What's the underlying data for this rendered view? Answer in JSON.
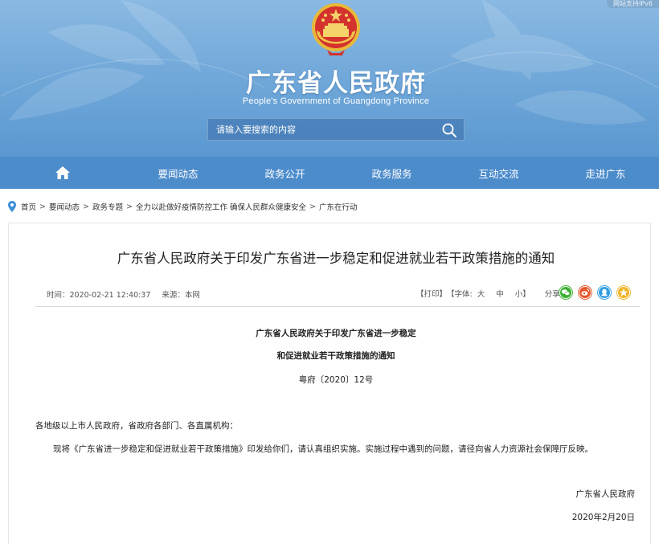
{
  "header": {
    "ipv6_badge": "网站支持IPv6",
    "title": "广东省人民政府",
    "subtitle": "People's Government of Guangdong Province",
    "search": {
      "placeholder": "请输入要搜索的内容"
    }
  },
  "nav": {
    "items": [
      {
        "label": "要闻动态"
      },
      {
        "label": "政务公开"
      },
      {
        "label": "政务服务"
      },
      {
        "label": "互动交流"
      },
      {
        "label": "走进广东"
      }
    ]
  },
  "breadcrumb": {
    "items": [
      "首页",
      "要闻动态",
      "政务专题",
      "全力以赴做好疫情防控工作 确保人民群众健康安全"
    ],
    "current": "广东在行动",
    "separator": ">"
  },
  "article": {
    "title": "广东省人民政府关于印发广东省进一步稳定和促进就业若干政策措施的通知",
    "meta": {
      "time": "时间：2020-02-21 12:40:37",
      "source": "来源：本网"
    },
    "tools": {
      "print": "【打印】",
      "font_label": "【字体:",
      "font_large": "大",
      "font_medium": "中",
      "font_small": "小",
      "font_close": "】",
      "share_label": "分享到:"
    },
    "share_icons": [
      "wechat-icon",
      "weibo-icon",
      "qq-icon",
      "qzone-icon"
    ],
    "doc": {
      "heading_line1": "广东省人民政府关于印发广东省进一步稳定",
      "heading_line2": "和促进就业若干政策措施的通知",
      "doc_number": "粤府〔2020〕12号",
      "salutation": "各地级以上市人民政府，省政府各部门、各直属机构：",
      "body": "现将《广东省进一步稳定和促进就业若干政策措施》印发给你们，请认真组织实施。实施过程中遇到的问题，请径向省人力资源社会保障厅反映。",
      "signature": "广东省人民政府",
      "date": "2020年2月20日"
    }
  },
  "colors": {
    "header_top": "#8ab9e2",
    "header_bottom": "#5a98d0",
    "nav_bg": "#4d8ccb",
    "wechat": "#3eb135",
    "weibo": "#e6552b",
    "qq": "#2f9de2",
    "qzone": "#f0b429"
  }
}
